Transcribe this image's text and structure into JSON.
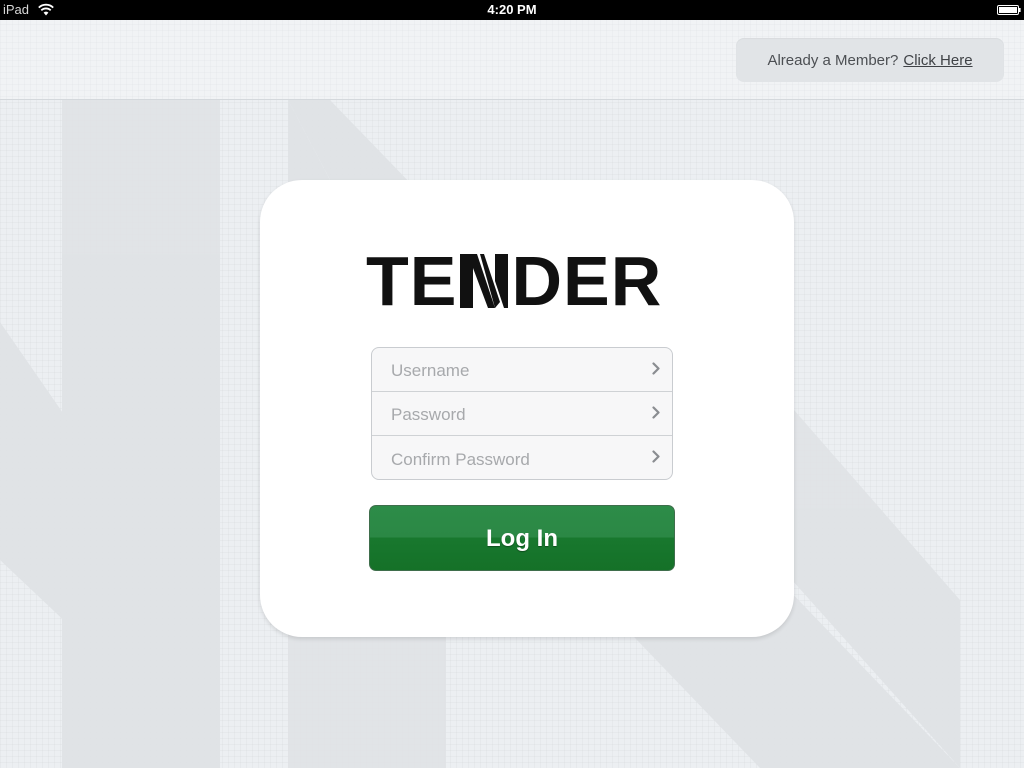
{
  "status_bar": {
    "device": "iPad",
    "time": "4:20 PM"
  },
  "header": {
    "member_prompt": "Already a Member?",
    "member_link": "Click Here"
  },
  "logo": {
    "part_before": "TE",
    "part_after": "DER"
  },
  "form": {
    "username_placeholder": "Username",
    "password_placeholder": "Password",
    "confirm_password_placeholder": "Confirm Password",
    "login_label": "Log In"
  },
  "colors": {
    "background": "#eceff2",
    "card": "#ffffff",
    "login_button": "#1a7a32",
    "status_bar": "#000000"
  },
  "icons": {
    "status_wifi": "wifi-icon",
    "status_battery": "battery-icon",
    "field_chevron": "chevron-right-icon"
  }
}
